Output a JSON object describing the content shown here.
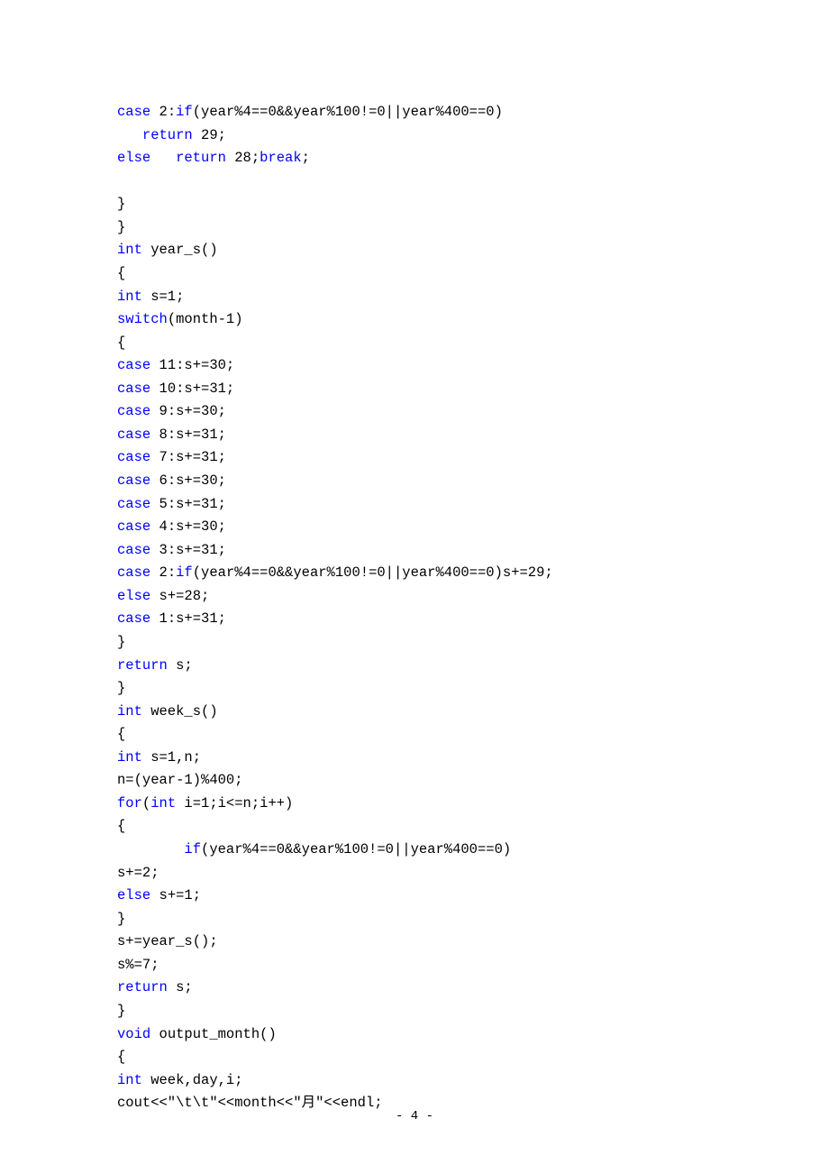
{
  "page_number": "- 4 -",
  "lines": [
    [
      {
        "t": "case",
        "k": true
      },
      {
        "t": " 2:",
        "k": false
      },
      {
        "t": "if",
        "k": true
      },
      {
        "t": "(year%4==0&&year%100!=0||year%400==0)",
        "k": false
      }
    ],
    [
      {
        "t": "   ",
        "k": false
      },
      {
        "t": "return",
        "k": true
      },
      {
        "t": " 29;",
        "k": false
      }
    ],
    [
      {
        "t": "else",
        "k": true
      },
      {
        "t": "   ",
        "k": false
      },
      {
        "t": "return",
        "k": true
      },
      {
        "t": " 28;",
        "k": false
      },
      {
        "t": "break",
        "k": true
      },
      {
        "t": ";",
        "k": false
      }
    ],
    [
      {
        "t": "",
        "k": false
      }
    ],
    [
      {
        "t": "}",
        "k": false
      }
    ],
    [
      {
        "t": "}",
        "k": false
      }
    ],
    [
      {
        "t": "int",
        "k": true
      },
      {
        "t": " year_s()",
        "k": false
      }
    ],
    [
      {
        "t": "{",
        "k": false
      }
    ],
    [
      {
        "t": "int",
        "k": true
      },
      {
        "t": " s=1;",
        "k": false
      }
    ],
    [
      {
        "t": "switch",
        "k": true
      },
      {
        "t": "(month-1)",
        "k": false
      }
    ],
    [
      {
        "t": "{",
        "k": false
      }
    ],
    [
      {
        "t": "case",
        "k": true
      },
      {
        "t": " 11:s+=30;",
        "k": false
      }
    ],
    [
      {
        "t": "case",
        "k": true
      },
      {
        "t": " 10:s+=31;",
        "k": false
      }
    ],
    [
      {
        "t": "case",
        "k": true
      },
      {
        "t": " 9:s+=30;",
        "k": false
      }
    ],
    [
      {
        "t": "case",
        "k": true
      },
      {
        "t": " 8:s+=31;",
        "k": false
      }
    ],
    [
      {
        "t": "case",
        "k": true
      },
      {
        "t": " 7:s+=31;",
        "k": false
      }
    ],
    [
      {
        "t": "case",
        "k": true
      },
      {
        "t": " 6:s+=30;",
        "k": false
      }
    ],
    [
      {
        "t": "case",
        "k": true
      },
      {
        "t": " 5:s+=31;",
        "k": false
      }
    ],
    [
      {
        "t": "case",
        "k": true
      },
      {
        "t": " 4:s+=30;",
        "k": false
      }
    ],
    [
      {
        "t": "case",
        "k": true
      },
      {
        "t": " 3:s+=31;",
        "k": false
      }
    ],
    [
      {
        "t": "case",
        "k": true
      },
      {
        "t": " 2:",
        "k": false
      },
      {
        "t": "if",
        "k": true
      },
      {
        "t": "(year%4==0&&year%100!=0||year%400==0)s+=29;",
        "k": false
      }
    ],
    [
      {
        "t": "else",
        "k": true
      },
      {
        "t": " s+=28;",
        "k": false
      }
    ],
    [
      {
        "t": "case",
        "k": true
      },
      {
        "t": " 1:s+=31;",
        "k": false
      }
    ],
    [
      {
        "t": "}",
        "k": false
      }
    ],
    [
      {
        "t": "return",
        "k": true
      },
      {
        "t": " s;",
        "k": false
      }
    ],
    [
      {
        "t": "}",
        "k": false
      }
    ],
    [
      {
        "t": "int",
        "k": true
      },
      {
        "t": " week_s()",
        "k": false
      }
    ],
    [
      {
        "t": "{",
        "k": false
      }
    ],
    [
      {
        "t": "int",
        "k": true
      },
      {
        "t": " s=1,n;",
        "k": false
      }
    ],
    [
      {
        "t": "n=(year-1)%400;",
        "k": false
      }
    ],
    [
      {
        "t": "for",
        "k": true
      },
      {
        "t": "(",
        "k": false
      },
      {
        "t": "int",
        "k": true
      },
      {
        "t": " i=1;i<=n;i++)",
        "k": false
      }
    ],
    [
      {
        "t": "{",
        "k": false
      }
    ],
    [
      {
        "t": "        ",
        "k": false
      },
      {
        "t": "if",
        "k": true
      },
      {
        "t": "(year%4==0&&year%100!=0||year%400==0)",
        "k": false
      }
    ],
    [
      {
        "t": "s+=2;",
        "k": false
      }
    ],
    [
      {
        "t": "else",
        "k": true
      },
      {
        "t": " s+=1;",
        "k": false
      }
    ],
    [
      {
        "t": "}",
        "k": false
      }
    ],
    [
      {
        "t": "s+=year_s();",
        "k": false
      }
    ],
    [
      {
        "t": "s%=7;",
        "k": false
      }
    ],
    [
      {
        "t": "return",
        "k": true
      },
      {
        "t": " s;",
        "k": false
      }
    ],
    [
      {
        "t": "}",
        "k": false
      }
    ],
    [
      {
        "t": "void",
        "k": true
      },
      {
        "t": " output_month()",
        "k": false
      }
    ],
    [
      {
        "t": "{",
        "k": false
      }
    ],
    [
      {
        "t": "int",
        "k": true
      },
      {
        "t": " week,day,i;",
        "k": false
      }
    ],
    [
      {
        "t": "cout<<\"\\t\\t\"<<month<<\"月\"<<endl;",
        "k": false
      }
    ]
  ]
}
